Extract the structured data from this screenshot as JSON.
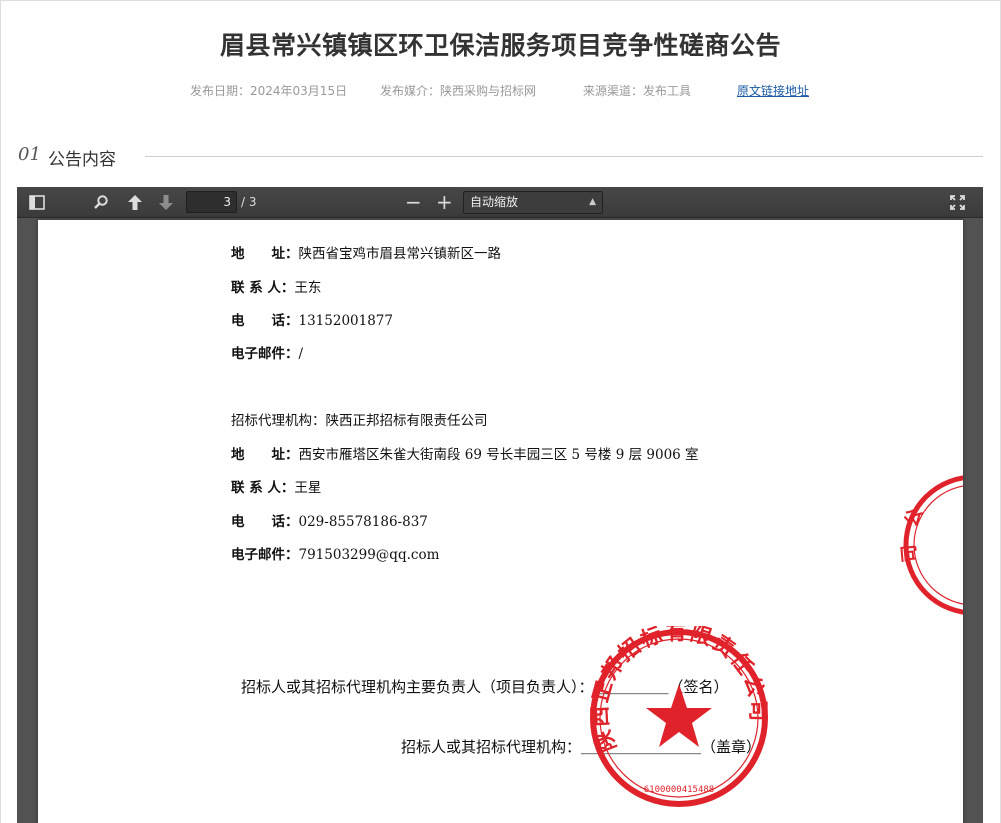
{
  "title": "眉县常兴镇镇区环卫保洁服务项目竞争性磋商公告",
  "meta": {
    "date": "发布日期：2024年03月15日",
    "media": "发布媒介：陕西采购与招标网",
    "source": "来源渠道：发布工具",
    "link": "原文链接地址"
  },
  "section": {
    "num": "01",
    "label": "公告内容"
  },
  "viewer": {
    "current_page": "3",
    "total_pages": "/ 3",
    "zoom": "自动缩放",
    "minus": "−",
    "plus": "+"
  },
  "doc": {
    "buyer": {
      "address_label": "地　　址：",
      "address": "陕西省宝鸡市眉县常兴镇新区一路",
      "contact_label": "联 系 人：",
      "contact": "王东",
      "phone_label": "电　　话：",
      "phone": "13152001877",
      "email_label": "电子邮件：",
      "email": "/"
    },
    "agency": {
      "heading": "招标代理机构：陕西正邦招标有限责任公司",
      "address_label": "地　　址：",
      "address": "西安市雁塔区朱雀大街南段 69 号长丰园三区 5 号楼 9 层 9006 室",
      "contact_label": "联 系 人：",
      "contact": "王星",
      "phone_label": "电　　话：",
      "phone": "029-85578186-837",
      "email_label": "电子邮件：",
      "email": "791503299@qq.com"
    },
    "signature_line": "招标人或其招标代理机构主要负责人（项目负责人）：＿＿＿＿＿（签名）",
    "stamp_line": "招标人或其招标代理机构：＿＿＿＿＿＿＿＿（盖章）",
    "seal_main_text": "陕西正邦招标有限责任公司",
    "seal_main_code": "6100000415488",
    "seal_partial_text": "公司"
  },
  "colors": {
    "seal": "#e0232b",
    "link": "#1a5aa3",
    "toolbar": "#3f3f3f",
    "viewer_bg": "#525252"
  }
}
